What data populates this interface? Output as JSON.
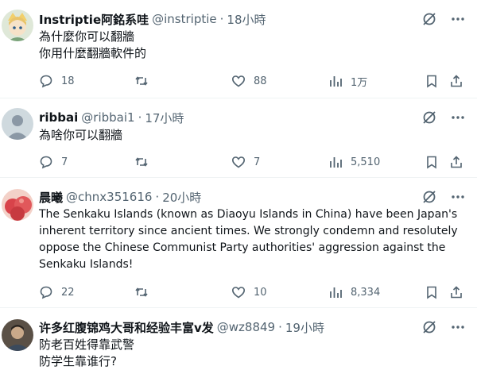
{
  "tweets": [
    {
      "name": "Instriptie阿銘系哇",
      "handle": "@instriptie",
      "time": "18小時",
      "text": "為什麼你可以翻牆\n你用什麼翻牆軟件的",
      "replies": "18",
      "retweets": "",
      "likes": "88",
      "views": "1万"
    },
    {
      "name": "ribbai",
      "handle": "@ribbai1",
      "time": "17小時",
      "text": "為啥你可以翻牆",
      "replies": "7",
      "retweets": "",
      "likes": "7",
      "views": "5,510"
    },
    {
      "name": "晨曦",
      "handle": "@chnx351616",
      "time": "20小時",
      "text": "The Senkaku Islands (known as Diaoyu Islands in China) have been Japan's inherent territory since ancient times. We strongly condemn and resolutely oppose the Chinese Communist Party authorities' aggression against the Senkaku Islands!",
      "replies": "22",
      "retweets": "",
      "likes": "10",
      "views": "8,334"
    },
    {
      "name": "许多红腹锦鸡大哥和经验丰富v发",
      "handle": "@wz8849",
      "time": "19小時",
      "text": "防老百姓得靠武警\n防学生靠谁行?",
      "replies": "",
      "retweets": "",
      "likes": "",
      "views": ""
    }
  ],
  "separator": "·",
  "colors": {
    "text_primary": "#0f1419",
    "text_secondary": "#536471",
    "divider": "#eff3f4"
  },
  "icons": [
    "grok-icon",
    "more-icon",
    "reply-icon",
    "retweet-icon",
    "like-icon",
    "views-icon",
    "bookmark-icon",
    "share-icon"
  ]
}
